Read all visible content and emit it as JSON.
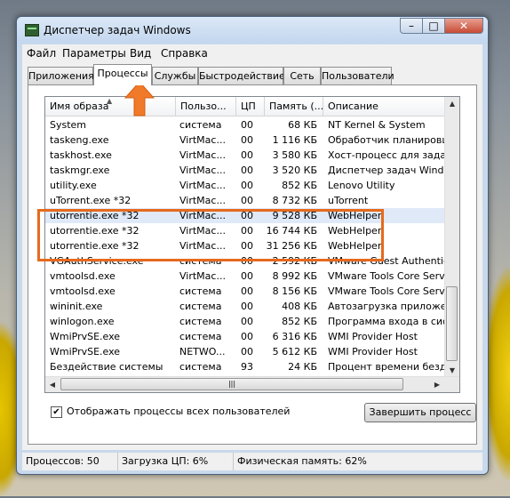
{
  "window": {
    "title": "Диспетчер задач Windows"
  },
  "menu": [
    "Файл",
    "Параметры",
    "Вид",
    "Справка"
  ],
  "tabs": [
    "Приложения",
    "Процессы",
    "Службы",
    "Быстродействие",
    "Сеть",
    "Пользователи"
  ],
  "active_tab": "Процессы",
  "columns": [
    "Имя образа",
    "Пользо...",
    "ЦП",
    "Память (...",
    "Описание"
  ],
  "processes": [
    {
      "name": "System",
      "user": "система",
      "cpu": "00",
      "mem": "68 КБ",
      "desc": "NT Kernel & System"
    },
    {
      "name": "taskeng.exe",
      "user": "VirtMac...",
      "cpu": "00",
      "mem": "1 116 КБ",
      "desc": "Обработчик планировщ"
    },
    {
      "name": "taskhost.exe",
      "user": "VirtMac...",
      "cpu": "00",
      "mem": "3 580 КБ",
      "desc": "Хост-процесс для задач W"
    },
    {
      "name": "taskmgr.exe",
      "user": "VirtMac...",
      "cpu": "00",
      "mem": "3 520 КБ",
      "desc": "Диспетчер задач Windows"
    },
    {
      "name": "utility.exe",
      "user": "VirtMac...",
      "cpu": "00",
      "mem": "852 КБ",
      "desc": "Lenovo Utility"
    },
    {
      "name": "uTorrent.exe *32",
      "user": "VirtMac...",
      "cpu": "00",
      "mem": "8 732 КБ",
      "desc": "uTorrent"
    },
    {
      "name": "utorrentie.exe *32",
      "user": "VirtMac...",
      "cpu": "00",
      "mem": "9 528 КБ",
      "desc": "WebHelper"
    },
    {
      "name": "utorrentie.exe *32",
      "user": "VirtMac...",
      "cpu": "00",
      "mem": "16 744 КБ",
      "desc": "WebHelper"
    },
    {
      "name": "utorrentie.exe *32",
      "user": "VirtMac...",
      "cpu": "00",
      "mem": "31 256 КБ",
      "desc": "WebHelper"
    },
    {
      "name": "VGAuthService.exe",
      "user": "система",
      "cpu": "00",
      "mem": "2 592 КБ",
      "desc": "VMware Guest Authenticati"
    },
    {
      "name": "vmtoolsd.exe",
      "user": "VirtMac...",
      "cpu": "00",
      "mem": "8 992 КБ",
      "desc": "VMware Tools Core Service"
    },
    {
      "name": "vmtoolsd.exe",
      "user": "система",
      "cpu": "00",
      "mem": "8 156 КБ",
      "desc": "VMware Tools Core Service"
    },
    {
      "name": "wininit.exe",
      "user": "система",
      "cpu": "00",
      "mem": "408 КБ",
      "desc": "Автозагрузка приложени"
    },
    {
      "name": "winlogon.exe",
      "user": "система",
      "cpu": "00",
      "mem": "852 КБ",
      "desc": "Программа входа в систе"
    },
    {
      "name": "WmiPrvSE.exe",
      "user": "система",
      "cpu": "00",
      "mem": "6 316 КБ",
      "desc": "WMI Provider Host"
    },
    {
      "name": "WmiPrvSE.exe",
      "user": "NETWO...",
      "cpu": "00",
      "mem": "5 612 КБ",
      "desc": "WMI Provider Host"
    },
    {
      "name": "Бездействие системы",
      "user": "система",
      "cpu": "93",
      "mem": "24 КБ",
      "desc": "Процент времени бездейс"
    }
  ],
  "selected_index": 6,
  "show_all_label": "Отображать процессы всех пользователей",
  "show_all_checked": true,
  "end_process_label": "Завершить процесс",
  "status": {
    "processes": "Процессов: 50",
    "cpu": "Загрузка ЦП: 6%",
    "memory": "Физическая память: 62%"
  },
  "colors": {
    "highlight": "#e66a1e",
    "selection": "#dfe9f8"
  }
}
